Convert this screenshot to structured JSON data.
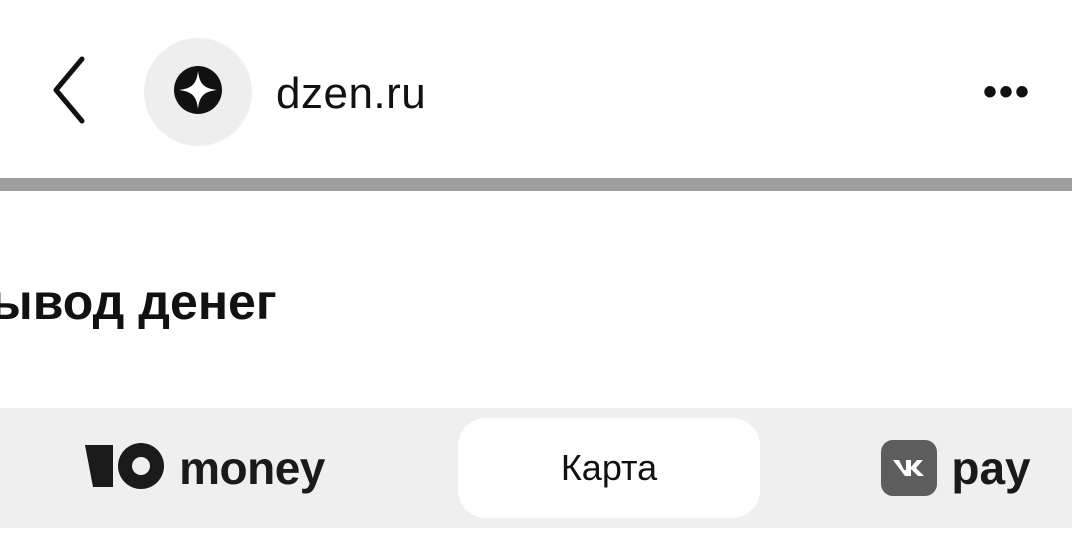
{
  "header": {
    "domain": "dzen.ru",
    "more_label": "•••"
  },
  "page": {
    "heading": "ывод денег"
  },
  "payment_methods": {
    "ymoney_label": "money",
    "card_label": "Карта",
    "vkpay_label": "pay",
    "selected": "Карта"
  },
  "icons": {
    "back": "chevron-left-icon",
    "site": "dzen-star-icon",
    "more": "more-horizontal-icon",
    "yoomoney": "yoomoney-logo-icon",
    "vk": "vk-logo-icon"
  }
}
